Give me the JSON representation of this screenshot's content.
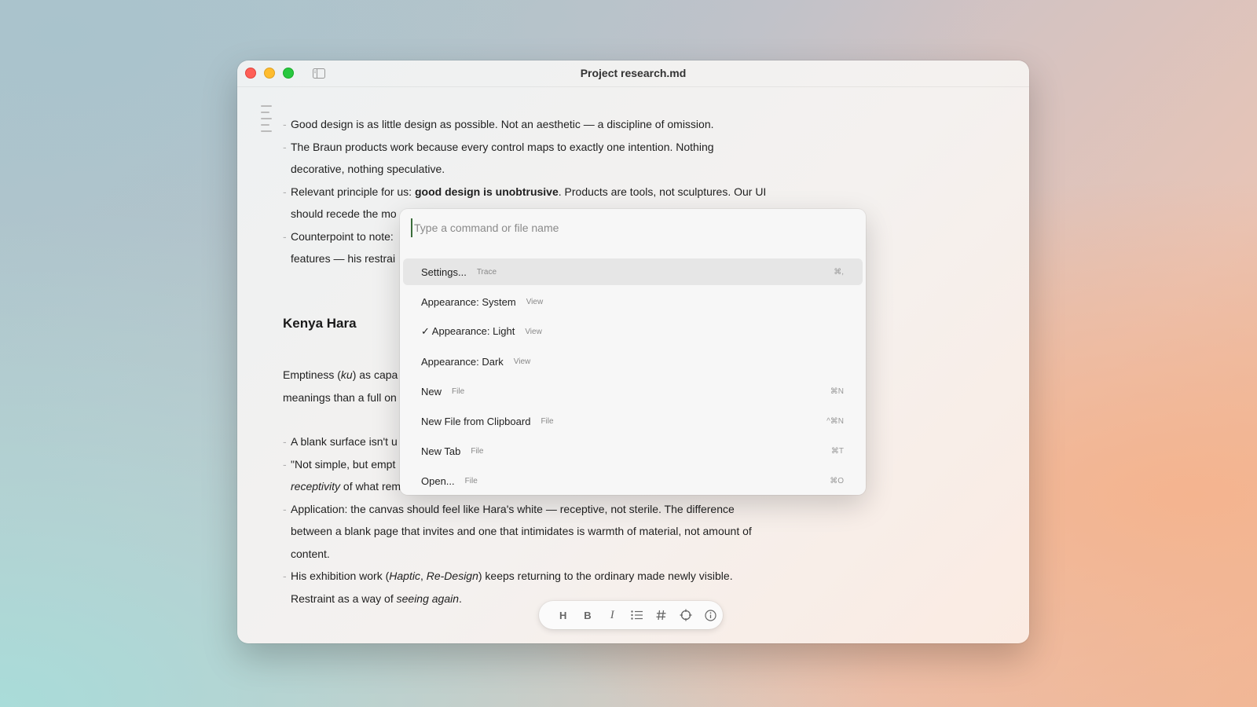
{
  "window": {
    "title": "Project research.md"
  },
  "document": {
    "bullets_braun": [
      {
        "lines": [
          "Good design is as little design as possible. Not an aesthetic — a discipline of omission."
        ]
      },
      {
        "lines": [
          "The Braun products work because every control maps to exactly one intention. Nothing",
          "decorative, nothing speculative."
        ]
      },
      {
        "pre": "Relevant principle for us: ",
        "bold": "good design is unobtrusive",
        "post": ". Products are tools, not sculptures. Our UI",
        "line2": "should recede the mo"
      },
      {
        "lines": [
          "Counterpoint to note:",
          "features — his restrai"
        ]
      }
    ],
    "heading_hara": "Kenya Hara",
    "hara_para": {
      "pre": "Emptiness (",
      "italic": "ku",
      "post": ") as capa",
      "line2": "meanings than a full on"
    },
    "bullets_hara": [
      {
        "lines": [
          "A blank surface isn't u"
        ]
      },
      {
        "line1": "\"Not simple, but empt",
        "italic": "receptivity",
        "post": " of what remains."
      },
      {
        "lines": [
          "Application: the canvas should feel like Hara's white — receptive, not sterile. The difference",
          "between a blank page that invites and one that intimidates is warmth of material, not amount of",
          "content."
        ]
      },
      {
        "pre": "His exhibition work (",
        "italic1": "Haptic",
        "mid": ", ",
        "italic2": "Re-Design",
        "post": ") keeps returning to the ordinary made newly visible.",
        "line2_pre": "Restraint as a way of ",
        "line2_italic": "seeing again",
        "line2_post": "."
      }
    ]
  },
  "palette": {
    "placeholder": "Type a command or file name",
    "commands": [
      {
        "label": "Settings...",
        "category": "Trace",
        "shortcut": "⌘,",
        "selected": true
      },
      {
        "label": "Appearance: System",
        "category": "View",
        "shortcut": ""
      },
      {
        "label": "✓ Appearance: Light",
        "category": "View",
        "shortcut": ""
      },
      {
        "label": "Appearance: Dark",
        "category": "View",
        "shortcut": ""
      },
      {
        "label": "New",
        "category": "File",
        "shortcut": "⌘N"
      },
      {
        "label": "New File from Clipboard",
        "category": "File",
        "shortcut": "^⌘N"
      },
      {
        "label": "New Tab",
        "category": "File",
        "shortcut": "⌘T"
      },
      {
        "label": "Open...",
        "category": "File",
        "shortcut": "⌘O"
      }
    ]
  },
  "toolbar": {
    "heading_label": "H",
    "bold_label": "B",
    "italic_label": "I",
    "icons": [
      "heading-icon",
      "bold-icon",
      "italic-icon",
      "list-icon",
      "hash-icon",
      "crosshair-icon",
      "info-icon"
    ]
  }
}
